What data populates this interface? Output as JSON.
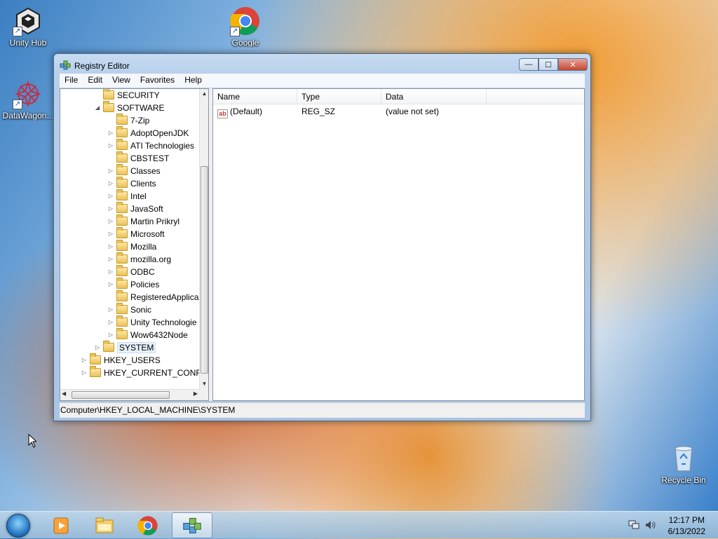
{
  "desktop": {
    "icons": [
      {
        "label": "Unity Hub",
        "icon": "unity-hub-icon"
      },
      {
        "label": "Google",
        "icon": "chrome-icon"
      },
      {
        "label": "DataWagon...",
        "icon": "datawagon-icon"
      },
      {
        "label": "Recycle Bin",
        "icon": "recycle-bin-icon"
      }
    ]
  },
  "window": {
    "title": "Registry Editor",
    "controls": {
      "minimize": "—",
      "maximize": "☐",
      "close": "✕"
    },
    "menu": [
      "File",
      "Edit",
      "View",
      "Favorites",
      "Help"
    ],
    "tree": [
      {
        "label": "SECURITY",
        "indent": 1,
        "expander": ""
      },
      {
        "label": "SOFTWARE",
        "indent": 1,
        "expander": "◢"
      },
      {
        "label": "7-Zip",
        "indent": 2,
        "expander": ""
      },
      {
        "label": "AdoptOpenJDK",
        "indent": 2,
        "expander": "▷"
      },
      {
        "label": "ATI Technologies",
        "indent": 2,
        "expander": "▷"
      },
      {
        "label": "CBSTEST",
        "indent": 2,
        "expander": ""
      },
      {
        "label": "Classes",
        "indent": 2,
        "expander": "▷"
      },
      {
        "label": "Clients",
        "indent": 2,
        "expander": "▷"
      },
      {
        "label": "Intel",
        "indent": 2,
        "expander": "▷"
      },
      {
        "label": "JavaSoft",
        "indent": 2,
        "expander": "▷"
      },
      {
        "label": "Martin Prikryl",
        "indent": 2,
        "expander": "▷"
      },
      {
        "label": "Microsoft",
        "indent": 2,
        "expander": "▷"
      },
      {
        "label": "Mozilla",
        "indent": 2,
        "expander": "▷"
      },
      {
        "label": "mozilla.org",
        "indent": 2,
        "expander": "▷"
      },
      {
        "label": "ODBC",
        "indent": 2,
        "expander": "▷"
      },
      {
        "label": "Policies",
        "indent": 2,
        "expander": "▷"
      },
      {
        "label": "RegisteredApplica",
        "indent": 2,
        "expander": ""
      },
      {
        "label": "Sonic",
        "indent": 2,
        "expander": "▷"
      },
      {
        "label": "Unity Technologie",
        "indent": 2,
        "expander": "▷"
      },
      {
        "label": "Wow6432Node",
        "indent": 2,
        "expander": "▷"
      },
      {
        "label": "SYSTEM",
        "indent": 1,
        "expander": "▷",
        "selected": true
      },
      {
        "label": "HKEY_USERS",
        "indent": 0,
        "expander": "▷"
      },
      {
        "label": "HKEY_CURRENT_CONFIG",
        "indent": 0,
        "expander": "▷"
      }
    ],
    "list": {
      "columns": [
        "Name",
        "Type",
        "Data"
      ],
      "rows": [
        {
          "name": "(Default)",
          "type": "REG_SZ",
          "data": "(value not set)",
          "icon": "string-value-icon"
        }
      ]
    },
    "status": "Computer\\HKEY_LOCAL_MACHINE\\SYSTEM"
  },
  "taskbar": {
    "buttons": [
      {
        "name": "media-player-icon",
        "active": false
      },
      {
        "name": "file-explorer-icon",
        "active": false
      },
      {
        "name": "chrome-icon",
        "active": false
      },
      {
        "name": "registry-editor-icon",
        "active": true
      }
    ],
    "clock": {
      "time": "12:17 PM",
      "date": "6/13/2022"
    }
  }
}
